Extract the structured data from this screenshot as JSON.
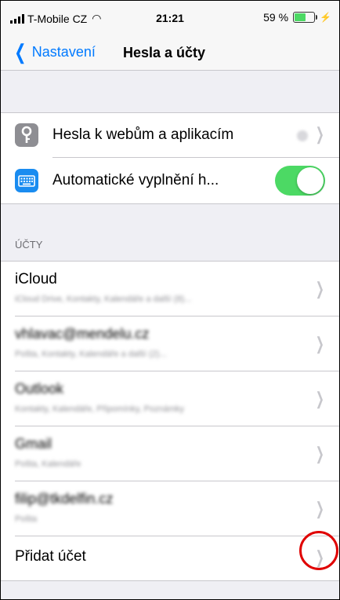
{
  "status_bar": {
    "carrier": "T-Mobile CZ",
    "time": "21:21",
    "battery": "59 %",
    "battery_level": 0.59
  },
  "nav": {
    "back_label": "Nastavení",
    "title": "Hesla a účty"
  },
  "passwords": {
    "item_label": "Hesla k webům a aplikacím",
    "autofill_label": "Automatické vyplnění h...",
    "autofill_on": true
  },
  "accounts_section": {
    "header": "ÚČTY",
    "items": [
      {
        "title": "iCloud",
        "detail": "iCloud Drive, Kontakty, Kalendáře a další (8)..."
      },
      {
        "title": "vhlavac@mendelu.cz",
        "detail": "Pošta, Kontakty, Kalendáře a další (2)..."
      },
      {
        "title": "Outlook",
        "detail": "Kontakty, Kalendáře, Připomínky, Poznámky"
      },
      {
        "title": "Gmail",
        "detail": "Pošta, Kalendáře"
      },
      {
        "title": "filip@tkdelfin.cz",
        "detail": "Pošta"
      }
    ],
    "add_label": "Přidat účet"
  },
  "colors": {
    "tint": "#007aff",
    "toggle_on": "#4cd964",
    "highlight_ring": "#e00000"
  },
  "icons": {
    "passwords": "key-icon",
    "autofill": "keyboard-icon",
    "disclosure": "chevron-right-icon"
  }
}
